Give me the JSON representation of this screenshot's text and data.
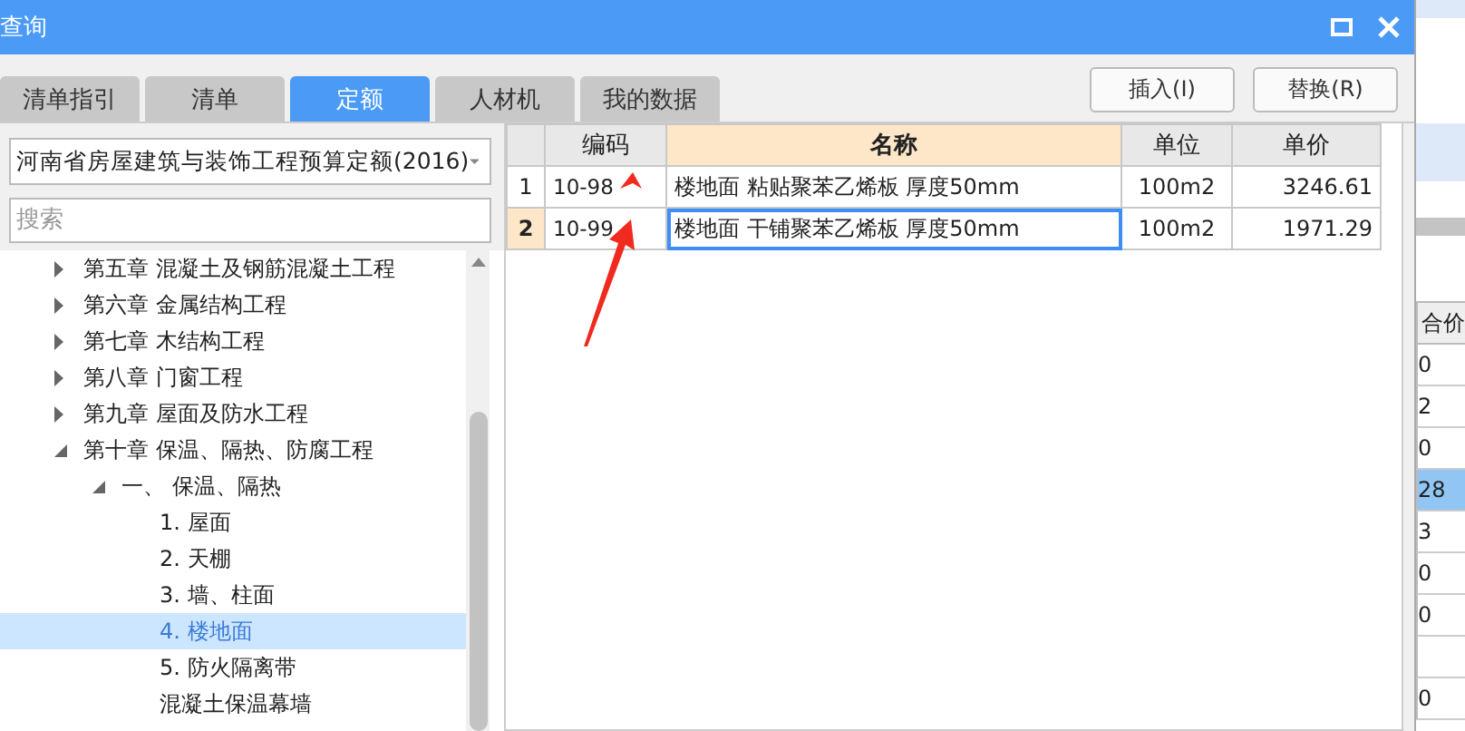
{
  "window": {
    "title": "查询"
  },
  "tabs": [
    {
      "label": "清单指引",
      "selected": false
    },
    {
      "label": "清单",
      "selected": false
    },
    {
      "label": "定额",
      "selected": true
    },
    {
      "label": "人材机",
      "selected": false
    },
    {
      "label": "我的数据",
      "selected": false
    }
  ],
  "actions": [
    "插入(I)",
    "替换(R)"
  ],
  "library": {
    "value": "河南省房屋建筑与装饰工程预算定额(2016)"
  },
  "search": {
    "placeholder": "搜索"
  },
  "tree": [
    {
      "label": "第五章 混凝土及钢筋混凝土工程",
      "expanded": false,
      "selected": false
    },
    {
      "label": "第六章 金属结构工程",
      "expanded": false,
      "selected": false
    },
    {
      "label": "第七章 木结构工程",
      "expanded": false,
      "selected": false
    },
    {
      "label": "第八章 门窗工程",
      "expanded": false,
      "selected": false
    },
    {
      "label": "第九章 屋面及防水工程",
      "expanded": false,
      "selected": false
    },
    {
      "label": "第十章 保温、隔热、防腐工程",
      "expanded": true,
      "selected": false,
      "children": [
        {
          "label": "一、  保温、隔热",
          "expanded": true,
          "selected": false,
          "children": [
            {
              "label": "1. 屋面",
              "selected": false
            },
            {
              "label": "2. 天棚",
              "selected": false
            },
            {
              "label": "3. 墙、柱面",
              "selected": false
            },
            {
              "label": "4. 楼地面",
              "selected": true
            },
            {
              "label": "5. 防火隔离带",
              "selected": false
            },
            {
              "label": "混凝土保温幕墙",
              "selected": false
            }
          ]
        }
      ]
    }
  ],
  "table": {
    "columns": [
      "编码",
      "名称",
      "单位",
      "单价"
    ],
    "rows": [
      {
        "index": "1",
        "code": "10-98",
        "name": "楼地面 粘贴聚苯乙烯板 厚度50mm",
        "unit": "100m2",
        "price": "3246.61",
        "selected": false
      },
      {
        "index": "2",
        "code": "10-99",
        "name": "楼地面 干铺聚苯乙烯板 厚度50mm",
        "unit": "100m2",
        "price": "1971.29",
        "selected": true
      }
    ]
  },
  "background_panel": {
    "column_header": "合价",
    "cells": [
      {
        "value": "0",
        "selected": false
      },
      {
        "value": "2",
        "selected": false
      },
      {
        "value": "0",
        "selected": false
      },
      {
        "value": "28",
        "selected": true
      },
      {
        "value": "3",
        "selected": false
      },
      {
        "value": "0",
        "selected": false
      },
      {
        "value": "0",
        "selected": false
      },
      {
        "selected": false
      },
      {
        "value": "0",
        "selected": false
      }
    ]
  }
}
